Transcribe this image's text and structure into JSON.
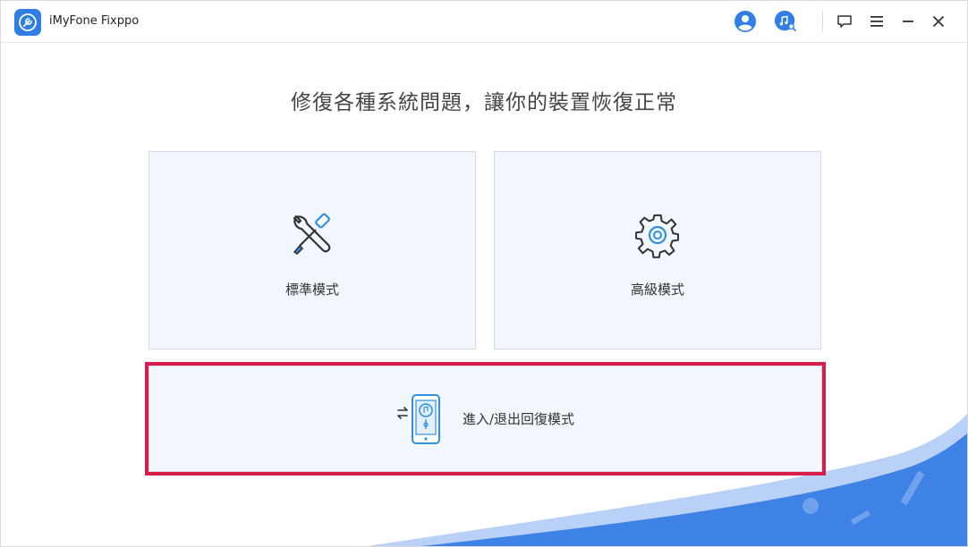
{
  "window": {
    "title": "iMyFone Fixppo"
  },
  "toolbar": {
    "icons": [
      "user-icon",
      "music-search-icon",
      "feedback-icon",
      "menu-icon",
      "minimize-icon",
      "close-icon"
    ]
  },
  "main": {
    "headline": "修復各種系統問題，讓你的裝置恢復正常",
    "modes": [
      {
        "label": "標準模式",
        "icon": "wrench-screwdriver-icon"
      },
      {
        "label": "高級模式",
        "icon": "gear-icon"
      }
    ],
    "recovery": {
      "label": "進入/退出回復模式",
      "icon": "phone-recovery-icon"
    }
  },
  "colors": {
    "accent": "#2f7fe6",
    "card_bg": "#f1f7fd",
    "highlight": "#d81d4a",
    "wave": "#3f82e6"
  }
}
